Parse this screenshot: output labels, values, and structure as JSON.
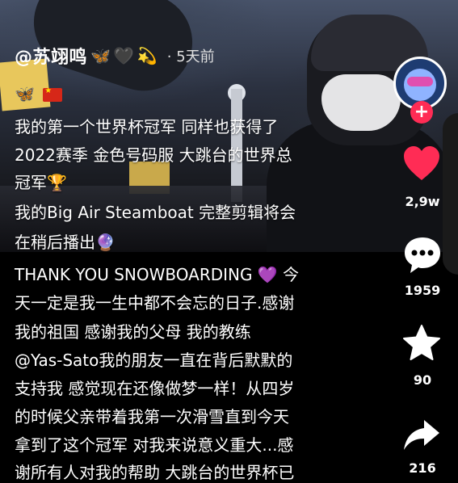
{
  "author": {
    "name": "@苏翊鸣",
    "emojis": [
      "🦋",
      "🖤",
      "💫"
    ],
    "separator": "·",
    "time": "5天前"
  },
  "caption": {
    "flags_line": "🦋",
    "lines": [
      "我的第一个世界杯冠军 同样也获得了",
      "2022赛季 金色号码服 大跳台的世界总",
      "冠军",
      "我的Big Air Steamboat 完整剪辑将会",
      "在稍后播出",
      "THANK YOU SNOWBOARDING",
      "今",
      "天一定是我一生中都不会忘的日子.感谢",
      "我的祖国 感谢我的父母 我的教练",
      "@Yas-Sato我的朋友一直在背后默默的",
      "支持我 感觉现在还像做梦一样！从四岁",
      "的时候父亲带着我第一次滑雪直到今天",
      "拿到了这个冠军 对我来说意义重大...感",
      "谢所有人对我的帮助 大跳台的世界杯已"
    ],
    "trophy": "🏆",
    "crystal_ball": "🔮",
    "purple_heart": "💜"
  },
  "actions": {
    "like_count": "2,9w",
    "comment_count": "1959",
    "favorite_count": "90",
    "share_count": "216"
  },
  "follow_symbol": "+",
  "colors": {
    "like": "#ff2c55",
    "follow": "#ff2c55",
    "text": "#ffffff"
  }
}
